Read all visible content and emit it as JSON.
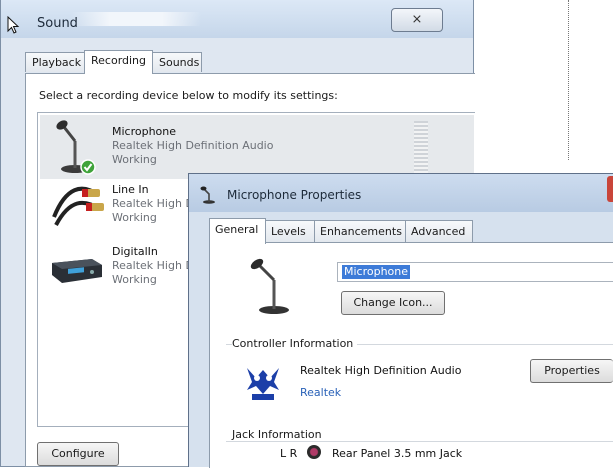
{
  "sound_window": {
    "title": "Sound",
    "close_symbol": "⨯",
    "tabs": [
      {
        "label": "Playback"
      },
      {
        "label": "Recording"
      },
      {
        "label": "Sounds"
      }
    ],
    "instruction": "Select a recording device below to modify its settings:",
    "devices": [
      {
        "name": "Microphone",
        "driver": "Realtek High Definition Audio",
        "status": "Working",
        "icon": "microphone-icon",
        "default": true
      },
      {
        "name": "Line In",
        "driver": "Realtek High Definition Audio",
        "status": "Working",
        "icon": "rca-cable-icon"
      },
      {
        "name": "DigitalIn",
        "driver": "Realtek High Definition Audio",
        "status": "Working",
        "icon": "digital-device-icon"
      }
    ],
    "configure_label": "Configure"
  },
  "properties_window": {
    "title": "Microphone Properties",
    "tabs": [
      {
        "label": "General"
      },
      {
        "label": "Levels"
      },
      {
        "label": "Enhancements"
      },
      {
        "label": "Advanced"
      }
    ],
    "device_name_value": "Microphone",
    "change_icon_label": "Change Icon...",
    "controller_header": "Controller Information",
    "controller_name": "Realtek High Definition Audio",
    "controller_vendor": "Realtek",
    "properties_label": "Properties",
    "jack_header": "Jack Information",
    "jack_channels": "L R",
    "jack_location": "Rear Panel 3.5 mm Jack",
    "jack_color": "#b03a67"
  }
}
